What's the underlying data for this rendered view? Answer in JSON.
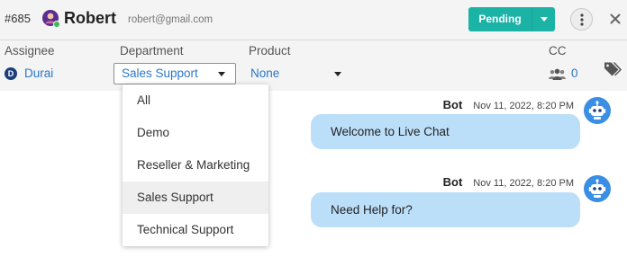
{
  "theme": {
    "accent": "#1bb3a5",
    "link": "#2a77c9",
    "bubble": "#bcdff9",
    "assignee_badge": "#1d3d7a",
    "bot_avatar": "#3a8ee4",
    "online": "#3cba54"
  },
  "header": {
    "ticket_id": "#685",
    "avatar_icon": "user-avatar-icon",
    "customer_name": "Robert",
    "customer_email": "robert@gmail.com",
    "status_button": {
      "label": "Pending",
      "caret_icon": "caret-down-icon"
    },
    "more_icon": "vertical-ellipsis-icon",
    "close_icon": "close-icon"
  },
  "fields": {
    "assignee": {
      "label": "Assignee",
      "initial": "D",
      "value": "Durai"
    },
    "department": {
      "label": "Department",
      "value": "Sales Support",
      "caret_icon": "caret-down-icon",
      "menu_open": true,
      "options": [
        {
          "label": "All"
        },
        {
          "label": "Demo"
        },
        {
          "label": "Reseller & Marketing"
        },
        {
          "label": "Sales Support",
          "highlighted": true
        },
        {
          "label": "Technical Support"
        }
      ]
    },
    "product": {
      "label": "Product",
      "value": "None",
      "caret_icon": "caret-down-icon"
    },
    "cc": {
      "label": "CC",
      "icon": "people-icon",
      "count": "0"
    },
    "tags": {
      "icon": "tag-icon"
    }
  },
  "messages": [
    {
      "sender": "Bot",
      "timestamp": "Nov 11, 2022, 8:20 PM",
      "text": "Welcome to Live Chat",
      "avatar_icon": "robot-avatar-icon"
    },
    {
      "sender": "Bot",
      "timestamp": "Nov 11, 2022, 8:20 PM",
      "text": "Need Help for?",
      "avatar_icon": "robot-avatar-icon"
    }
  ]
}
